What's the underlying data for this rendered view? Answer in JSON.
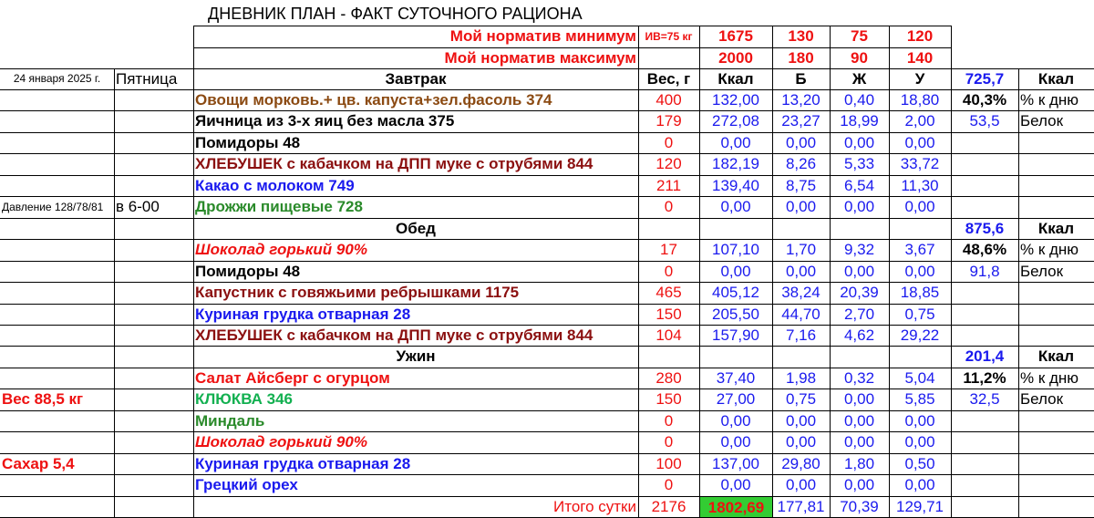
{
  "colors": {
    "red": "#ee1111",
    "blue": "#1a1aee",
    "brown": "#8b4a12",
    "maroon": "#8b1010",
    "green": "#2a8a2a",
    "bright_green": "#12b050",
    "black": "#000000",
    "highlight_fill": "#33cc33"
  },
  "title": "ДНЕВНИК ПЛАН - ФАКТ СУТОЧНОГО РАЦИОНА",
  "norms": {
    "min_label": "Мой норматив минимум",
    "iv": "ИВ=75 кг",
    "min": [
      "1675",
      "130",
      "75",
      "120"
    ],
    "max_label": "Мой норматив максимум",
    "max": [
      "2000",
      "180",
      "90",
      "140"
    ]
  },
  "left": {
    "date": "24 января 2025 г.",
    "weekday": "Пятница",
    "pressure": "Давление 128/78/81",
    "time": "в 6-00",
    "weight": "Вес 88,5 кг",
    "sugar": "Сахар 5,4"
  },
  "headers": {
    "breakfast": "Завтрак",
    "lunch": "Обед",
    "dinner": "Ужин",
    "weight": "Вес, г",
    "kcal": "Ккал",
    "b": "Б",
    "zh": "Ж",
    "u": "У"
  },
  "meal_summaries": {
    "breakfast": {
      "kcal": "725,7",
      "kcal_unit": "Ккал",
      "pct": "40,3%",
      "pct_label": "% к дню",
      "protein": "53,5",
      "protein_label": "Белок"
    },
    "lunch": {
      "kcal": "875,6",
      "kcal_unit": "Ккал",
      "pct": "48,6%",
      "pct_label": "% к дню",
      "protein": "91,8",
      "protein_label": "Белок"
    },
    "dinner": {
      "kcal": "201,4",
      "kcal_unit": "Ккал",
      "pct": "11,2%",
      "pct_label": "% к дню",
      "protein": "32,5",
      "protein_label": "Белок"
    }
  },
  "rows": [
    {
      "name": "Овощи морковь.+ цв. капуста+зел.фасоль 374",
      "color": "brown",
      "style": "b",
      "weight": "400",
      "kcal": "132,00",
      "b": "13,20",
      "zh": "0,40",
      "u": "18,80"
    },
    {
      "name": "Яичница из 3-х яиц без масла 375",
      "color": "black",
      "style": "b",
      "weight": "179",
      "kcal": "272,08",
      "b": "23,27",
      "zh": "18,99",
      "u": "2,00"
    },
    {
      "name": "Помидоры 48",
      "color": "black",
      "style": "b",
      "weight": "0",
      "kcal": "0,00",
      "b": "0,00",
      "zh": "0,00",
      "u": "0,00"
    },
    {
      "name": "ХЛЕБУШЕК с кабачком на ДПП муке с отрубями 844",
      "color": "maroon",
      "style": "b",
      "weight": "120",
      "kcal": "182,19",
      "b": "8,26",
      "zh": "5,33",
      "u": "33,72"
    },
    {
      "name": "Какао с молоком 749",
      "color": "blue",
      "style": "b",
      "weight": "211",
      "kcal": "139,40",
      "b": "8,75",
      "zh": "6,54",
      "u": "11,30"
    },
    {
      "name": "Дрожжи пищевые 728",
      "color": "green",
      "style": "b",
      "weight": "0",
      "kcal": "0,00",
      "b": "0,00",
      "zh": "0,00",
      "u": "0,00"
    },
    {
      "name": "Шоколад горький 90%",
      "color": "red",
      "style": "bi",
      "weight": "17",
      "kcal": "107,10",
      "b": "1,70",
      "zh": "9,32",
      "u": "3,67"
    },
    {
      "name": "Помидоры 48",
      "color": "black",
      "style": "b",
      "weight": "0",
      "kcal": "0,00",
      "b": "0,00",
      "zh": "0,00",
      "u": "0,00"
    },
    {
      "name": "Капустник с говяжьими ребрышками 1175",
      "color": "maroon",
      "style": "b",
      "weight": "465",
      "kcal": "405,12",
      "b": "38,24",
      "zh": "20,39",
      "u": "18,85"
    },
    {
      "name": "Куриная грудка отварная 28",
      "color": "blue",
      "style": "b",
      "weight": "150",
      "kcal": "205,50",
      "b": "44,70",
      "zh": "2,70",
      "u": "0,75"
    },
    {
      "name": "ХЛЕБУШЕК с кабачком на ДПП муке с отрубями 844",
      "color": "maroon",
      "style": "b",
      "weight": "104",
      "kcal": "157,90",
      "b": "7,16",
      "zh": "4,62",
      "u": "29,22"
    },
    {
      "name": "Салат Айсберг с огурцом",
      "color": "red",
      "style": "b",
      "weight": "280",
      "kcal": "37,40",
      "b": "1,98",
      "zh": "0,32",
      "u": "5,04"
    },
    {
      "name": "КЛЮКВА 346",
      "color": "bright_green",
      "style": "b",
      "weight": "150",
      "kcal": "27,00",
      "b": "0,75",
      "zh": "0,00",
      "u": "5,85"
    },
    {
      "name": "Миндаль",
      "color": "green",
      "style": "b",
      "weight": "0",
      "kcal": "0,00",
      "b": "0,00",
      "zh": "0,00",
      "u": "0,00"
    },
    {
      "name": "Шоколад горький 90%",
      "color": "red",
      "style": "bi",
      "weight": "0",
      "kcal": "0,00",
      "b": "0,00",
      "zh": "0,00",
      "u": "0,00"
    },
    {
      "name": "Куриная грудка отварная 28",
      "color": "blue",
      "style": "b",
      "weight": "100",
      "kcal": "137,00",
      "b": "29,80",
      "zh": "1,80",
      "u": "0,50"
    },
    {
      "name": "Грецкий орех",
      "color": "blue",
      "style": "b",
      "weight": "0",
      "kcal": "0,00",
      "b": "0,00",
      "zh": "0,00",
      "u": "0,00"
    }
  ],
  "totals": {
    "label": "Итого сутки",
    "weight": "2176",
    "kcal": "1802,69",
    "b": "177,81",
    "zh": "70,39",
    "u": "129,71"
  }
}
